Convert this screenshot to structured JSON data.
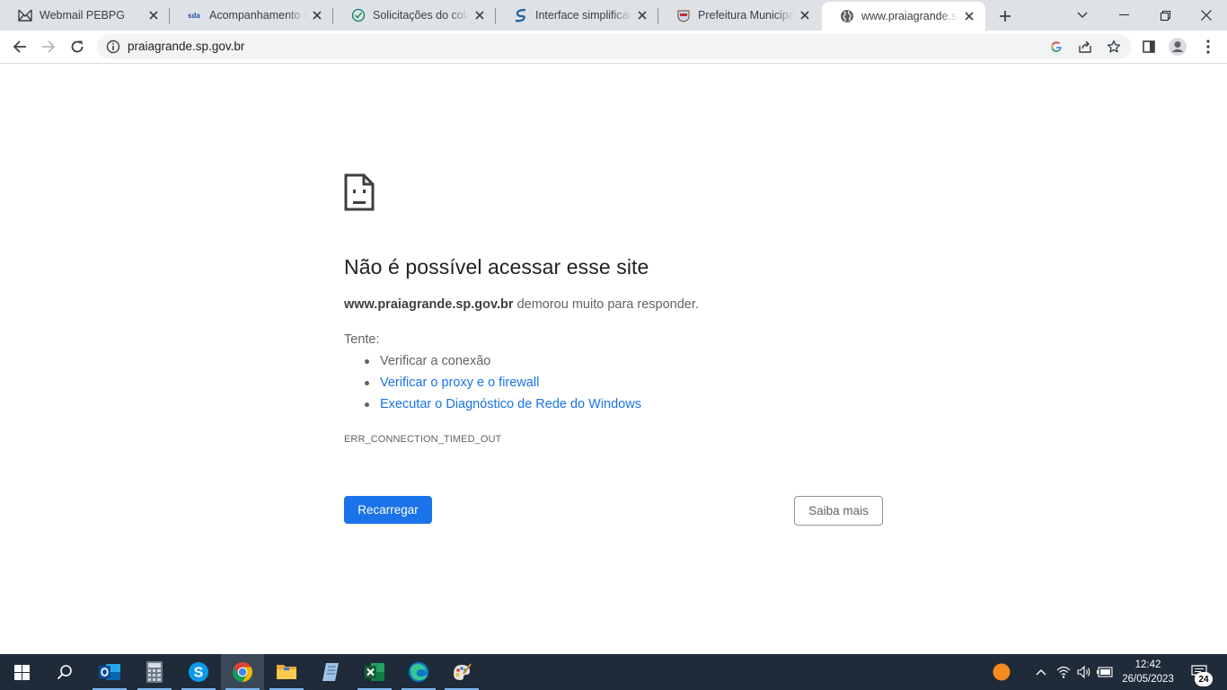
{
  "browser": {
    "tabs": [
      {
        "title": "Webmail PEBPG",
        "favicon": "webmail-icon"
      },
      {
        "title": "Acompanhamento de",
        "favicon": "sda-icon"
      },
      {
        "title": "Solicitações do colabo",
        "favicon": "check-icon"
      },
      {
        "title": "Interface simplificada",
        "favicon": "s-logo-icon"
      },
      {
        "title": "Prefeitura Municipal d",
        "favicon": "crest-icon"
      },
      {
        "title": "www.praiagrande.sp.g",
        "favicon": "globe-icon",
        "active": true
      }
    ],
    "url": "praiagrande.sp.gov.br"
  },
  "error_page": {
    "title": "Não é possível acessar esse site",
    "host": "www.praiagrande.sp.gov.br",
    "message": " demorou muito para responder.",
    "try_label": "Tente:",
    "suggestions": [
      {
        "text": "Verificar a conexão",
        "link": false
      },
      {
        "text": "Verificar o proxy e o firewall",
        "link": true
      },
      {
        "text": "Executar o Diagnóstico de Rede do Windows",
        "link": true
      }
    ],
    "error_code": "ERR_CONNECTION_TIMED_OUT",
    "reload_label": "Recarregar",
    "more_label": "Saiba mais"
  },
  "taskbar": {
    "time": "12:42",
    "date": "26/05/2023",
    "notifications": "24"
  },
  "colors": {
    "accent": "#1a73e8",
    "taskbar": "#1f2b38",
    "tabstrip": "#dee1e6"
  }
}
